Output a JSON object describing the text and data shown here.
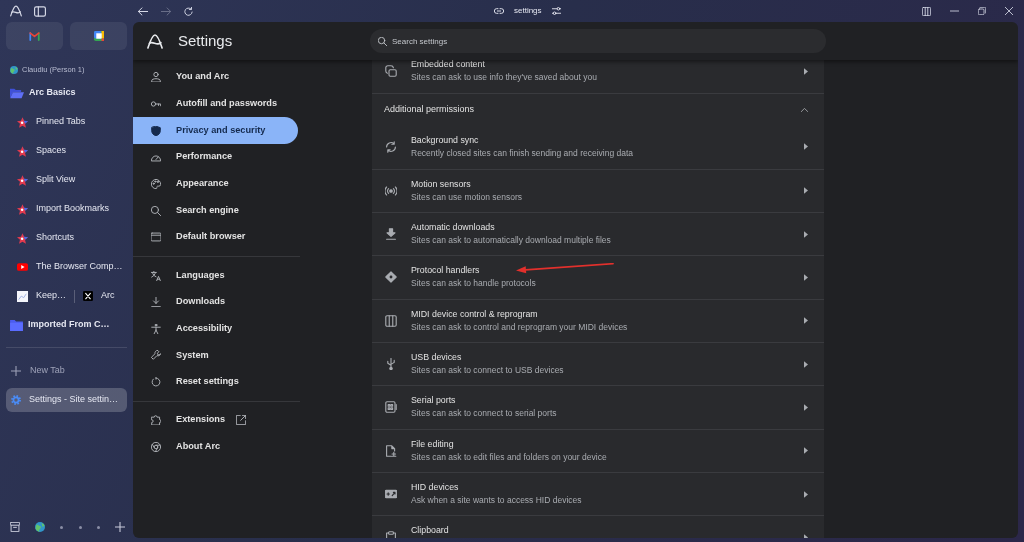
{
  "browser": {
    "nav_buttons": [
      {
        "kind": "back",
        "disabled": false
      },
      {
        "kind": "forward",
        "disabled": true
      },
      {
        "kind": "reload",
        "disabled": false
      }
    ],
    "address": "settings"
  },
  "sidebar": {
    "pinned": [
      {
        "kind": "mail"
      },
      {
        "kind": "calendar"
      }
    ],
    "profile": "Claudiu (Person 1)",
    "folders": [
      {
        "label": "Arc Basics",
        "expanded": true,
        "children": [
          {
            "kind": "page",
            "label": "Pinned Tabs"
          },
          {
            "kind": "page",
            "label": "Spaces"
          },
          {
            "kind": "page",
            "label": "Split View"
          },
          {
            "kind": "page",
            "label": "Import Bookmarks"
          },
          {
            "kind": "page",
            "label": "Shortcuts"
          },
          {
            "kind": "video",
            "label": "The Browser Comp…"
          },
          {
            "kind": "split",
            "parts": [
              {
                "label": "Keep…"
              },
              {
                "label": "Arc"
              }
            ]
          }
        ]
      },
      {
        "label": "Imported From C…",
        "expanded": false
      }
    ],
    "new_tab": "New Tab",
    "tabs": [
      {
        "label": "Settings - Site settin…",
        "selected": true
      }
    ],
    "spaces": [
      {
        "selected": true
      },
      {
        "selected": false
      },
      {
        "selected": false
      },
      {
        "selected": false
      }
    ]
  },
  "settings": {
    "title": "Settings",
    "search": {
      "placeholder": "Search settings"
    },
    "nav_groups": [
      [
        {
          "label": "You and Arc",
          "selected": false,
          "external": false
        },
        {
          "label": "Autofill and passwords",
          "selected": false,
          "external": false
        },
        {
          "label": "Privacy and security",
          "selected": true,
          "external": false
        },
        {
          "label": "Performance",
          "selected": false,
          "external": false
        },
        {
          "label": "Appearance",
          "selected": false,
          "external": false
        },
        {
          "label": "Search engine",
          "selected": false,
          "external": false
        },
        {
          "label": "Default browser",
          "selected": false,
          "external": false
        }
      ],
      [
        {
          "label": "Languages",
          "selected": false,
          "external": false
        },
        {
          "label": "Downloads",
          "selected": false,
          "external": false
        },
        {
          "label": "Accessibility",
          "selected": false,
          "external": false
        },
        {
          "label": "System",
          "selected": false,
          "external": false
        },
        {
          "label": "Reset settings",
          "selected": false,
          "external": false
        }
      ],
      [
        {
          "label": "Extensions",
          "selected": false,
          "external": true
        },
        {
          "label": "About Arc",
          "selected": false,
          "external": false
        }
      ]
    ],
    "content": {
      "rows": [
        {
          "title": "Embedded content",
          "description": "Sites can ask to use info they've saved about you",
          "annotated": false
        }
      ],
      "section": {
        "heading": "Additional permissions",
        "expanded": true,
        "rows": [
          {
            "title": "Background sync",
            "description": "Recently closed sites can finish sending and receiving data",
            "annotated": false
          },
          {
            "title": "Motion sensors",
            "description": "Sites can use motion sensors",
            "annotated": false
          },
          {
            "title": "Automatic downloads",
            "description": "Sites can ask to automatically download multiple files",
            "annotated": false
          },
          {
            "title": "Protocol handlers",
            "description": "Sites can ask to handle protocols",
            "annotated": true
          },
          {
            "title": "MIDI device control & reprogram",
            "description": "Sites can ask to control and reprogram your MIDI devices",
            "annotated": false
          },
          {
            "title": "USB devices",
            "description": "Sites can ask to connect to USB devices",
            "annotated": false
          },
          {
            "title": "Serial ports",
            "description": "Sites can ask to connect to serial ports",
            "annotated": false
          },
          {
            "title": "File editing",
            "description": "Sites can ask to edit files and folders on your device",
            "annotated": false
          },
          {
            "title": "HID devices",
            "description": "Ask when a site wants to access HID devices",
            "annotated": false
          },
          {
            "title": "Clipboard",
            "annotated": false
          }
        ]
      }
    }
  }
}
